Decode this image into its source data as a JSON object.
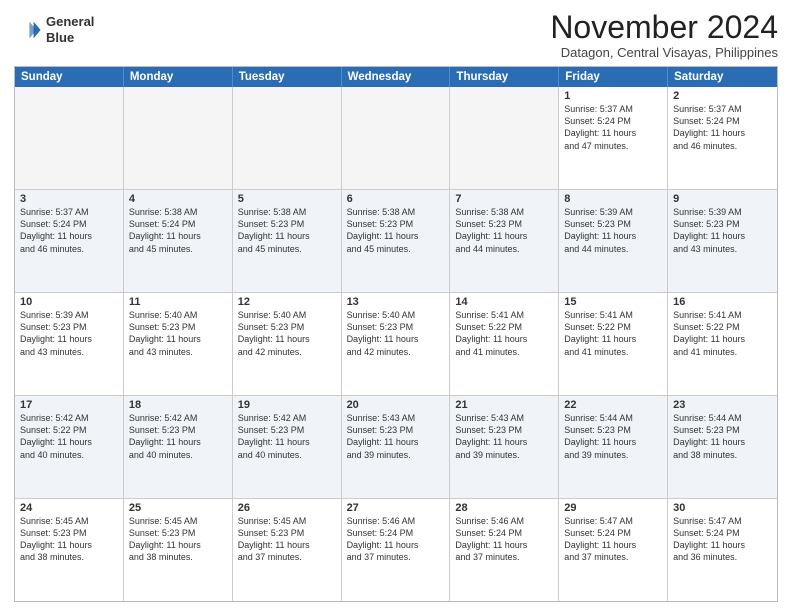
{
  "logo": {
    "line1": "General",
    "line2": "Blue"
  },
  "title": "November 2024",
  "location": "Datagon, Central Visayas, Philippines",
  "header": {
    "days": [
      "Sunday",
      "Monday",
      "Tuesday",
      "Wednesday",
      "Thursday",
      "Friday",
      "Saturday"
    ]
  },
  "rows": [
    {
      "cells": [
        {
          "empty": true
        },
        {
          "empty": true
        },
        {
          "empty": true
        },
        {
          "empty": true
        },
        {
          "empty": true
        },
        {
          "day": "1",
          "info": "Sunrise: 5:37 AM\nSunset: 5:24 PM\nDaylight: 11 hours\nand 47 minutes."
        },
        {
          "day": "2",
          "info": "Sunrise: 5:37 AM\nSunset: 5:24 PM\nDaylight: 11 hours\nand 46 minutes."
        }
      ]
    },
    {
      "cells": [
        {
          "day": "3",
          "info": "Sunrise: 5:37 AM\nSunset: 5:24 PM\nDaylight: 11 hours\nand 46 minutes."
        },
        {
          "day": "4",
          "info": "Sunrise: 5:38 AM\nSunset: 5:24 PM\nDaylight: 11 hours\nand 45 minutes."
        },
        {
          "day": "5",
          "info": "Sunrise: 5:38 AM\nSunset: 5:23 PM\nDaylight: 11 hours\nand 45 minutes."
        },
        {
          "day": "6",
          "info": "Sunrise: 5:38 AM\nSunset: 5:23 PM\nDaylight: 11 hours\nand 45 minutes."
        },
        {
          "day": "7",
          "info": "Sunrise: 5:38 AM\nSunset: 5:23 PM\nDaylight: 11 hours\nand 44 minutes."
        },
        {
          "day": "8",
          "info": "Sunrise: 5:39 AM\nSunset: 5:23 PM\nDaylight: 11 hours\nand 44 minutes."
        },
        {
          "day": "9",
          "info": "Sunrise: 5:39 AM\nSunset: 5:23 PM\nDaylight: 11 hours\nand 43 minutes."
        }
      ]
    },
    {
      "cells": [
        {
          "day": "10",
          "info": "Sunrise: 5:39 AM\nSunset: 5:23 PM\nDaylight: 11 hours\nand 43 minutes."
        },
        {
          "day": "11",
          "info": "Sunrise: 5:40 AM\nSunset: 5:23 PM\nDaylight: 11 hours\nand 43 minutes."
        },
        {
          "day": "12",
          "info": "Sunrise: 5:40 AM\nSunset: 5:23 PM\nDaylight: 11 hours\nand 42 minutes."
        },
        {
          "day": "13",
          "info": "Sunrise: 5:40 AM\nSunset: 5:23 PM\nDaylight: 11 hours\nand 42 minutes."
        },
        {
          "day": "14",
          "info": "Sunrise: 5:41 AM\nSunset: 5:22 PM\nDaylight: 11 hours\nand 41 minutes."
        },
        {
          "day": "15",
          "info": "Sunrise: 5:41 AM\nSunset: 5:22 PM\nDaylight: 11 hours\nand 41 minutes."
        },
        {
          "day": "16",
          "info": "Sunrise: 5:41 AM\nSunset: 5:22 PM\nDaylight: 11 hours\nand 41 minutes."
        }
      ]
    },
    {
      "cells": [
        {
          "day": "17",
          "info": "Sunrise: 5:42 AM\nSunset: 5:22 PM\nDaylight: 11 hours\nand 40 minutes."
        },
        {
          "day": "18",
          "info": "Sunrise: 5:42 AM\nSunset: 5:23 PM\nDaylight: 11 hours\nand 40 minutes."
        },
        {
          "day": "19",
          "info": "Sunrise: 5:42 AM\nSunset: 5:23 PM\nDaylight: 11 hours\nand 40 minutes."
        },
        {
          "day": "20",
          "info": "Sunrise: 5:43 AM\nSunset: 5:23 PM\nDaylight: 11 hours\nand 39 minutes."
        },
        {
          "day": "21",
          "info": "Sunrise: 5:43 AM\nSunset: 5:23 PM\nDaylight: 11 hours\nand 39 minutes."
        },
        {
          "day": "22",
          "info": "Sunrise: 5:44 AM\nSunset: 5:23 PM\nDaylight: 11 hours\nand 39 minutes."
        },
        {
          "day": "23",
          "info": "Sunrise: 5:44 AM\nSunset: 5:23 PM\nDaylight: 11 hours\nand 38 minutes."
        }
      ]
    },
    {
      "cells": [
        {
          "day": "24",
          "info": "Sunrise: 5:45 AM\nSunset: 5:23 PM\nDaylight: 11 hours\nand 38 minutes."
        },
        {
          "day": "25",
          "info": "Sunrise: 5:45 AM\nSunset: 5:23 PM\nDaylight: 11 hours\nand 38 minutes."
        },
        {
          "day": "26",
          "info": "Sunrise: 5:45 AM\nSunset: 5:23 PM\nDaylight: 11 hours\nand 37 minutes."
        },
        {
          "day": "27",
          "info": "Sunrise: 5:46 AM\nSunset: 5:24 PM\nDaylight: 11 hours\nand 37 minutes."
        },
        {
          "day": "28",
          "info": "Sunrise: 5:46 AM\nSunset: 5:24 PM\nDaylight: 11 hours\nand 37 minutes."
        },
        {
          "day": "29",
          "info": "Sunrise: 5:47 AM\nSunset: 5:24 PM\nDaylight: 11 hours\nand 37 minutes."
        },
        {
          "day": "30",
          "info": "Sunrise: 5:47 AM\nSunset: 5:24 PM\nDaylight: 11 hours\nand 36 minutes."
        }
      ]
    }
  ]
}
